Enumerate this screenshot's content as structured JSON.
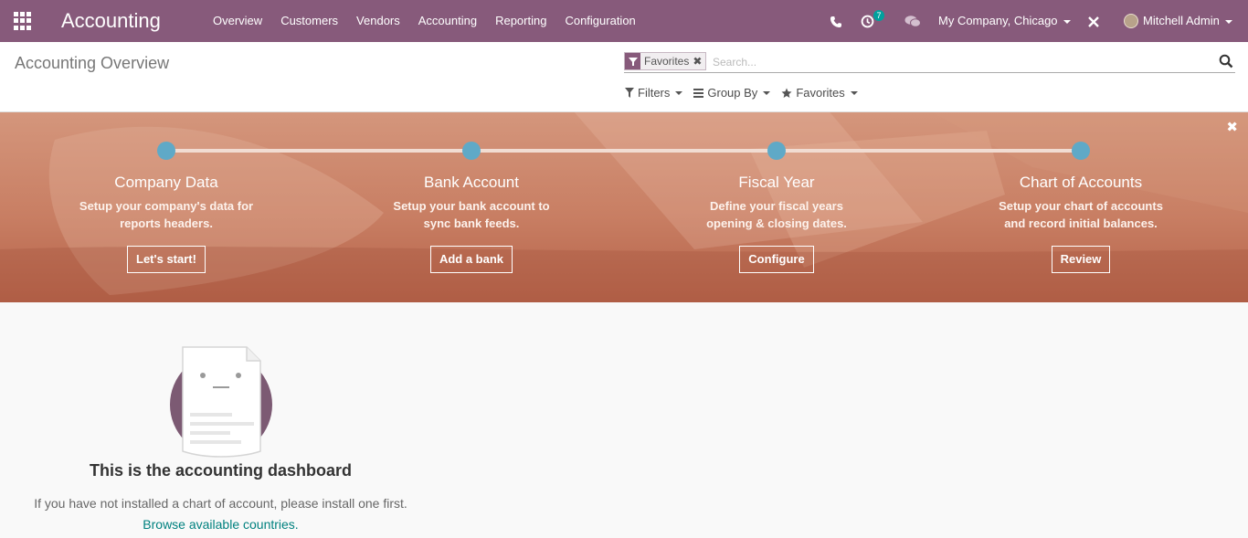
{
  "navbar": {
    "brand": "Accounting",
    "menu": [
      "Overview",
      "Customers",
      "Vendors",
      "Accounting",
      "Reporting",
      "Configuration"
    ],
    "activity_count": "7",
    "company": "My Company, Chicago",
    "user": "Mitchell Admin",
    "color": "#875a7b"
  },
  "control_panel": {
    "title": "Accounting Overview",
    "facet_label": "Favorites",
    "facet_close": "✖",
    "search_placeholder": "Search...",
    "filters_label": "Filters",
    "groupby_label": "Group By",
    "favorites_label": "Favorites"
  },
  "banner": {
    "close": "✖",
    "steps": [
      {
        "title": "Company Data",
        "description": "Setup your company's data for reports headers.",
        "button": "Let's start!"
      },
      {
        "title": "Bank Account",
        "description": "Setup your bank account to sync bank feeds.",
        "button": "Add a bank"
      },
      {
        "title": "Fiscal Year",
        "description": "Define your fiscal years opening & closing dates.",
        "button": "Configure"
      },
      {
        "title": "Chart of Accounts",
        "description": "Setup your chart of accounts and record initial balances.",
        "button": "Review"
      }
    ]
  },
  "dashboard": {
    "title": "This is the accounting dashboard",
    "text": "If you have not installed a chart of account, please install one first.",
    "link": "Browse available countries."
  },
  "colors": {
    "primary": "#875a7b",
    "link": "#00817f",
    "step_dot": "#5fa9c7",
    "badge": "#00a09d"
  }
}
